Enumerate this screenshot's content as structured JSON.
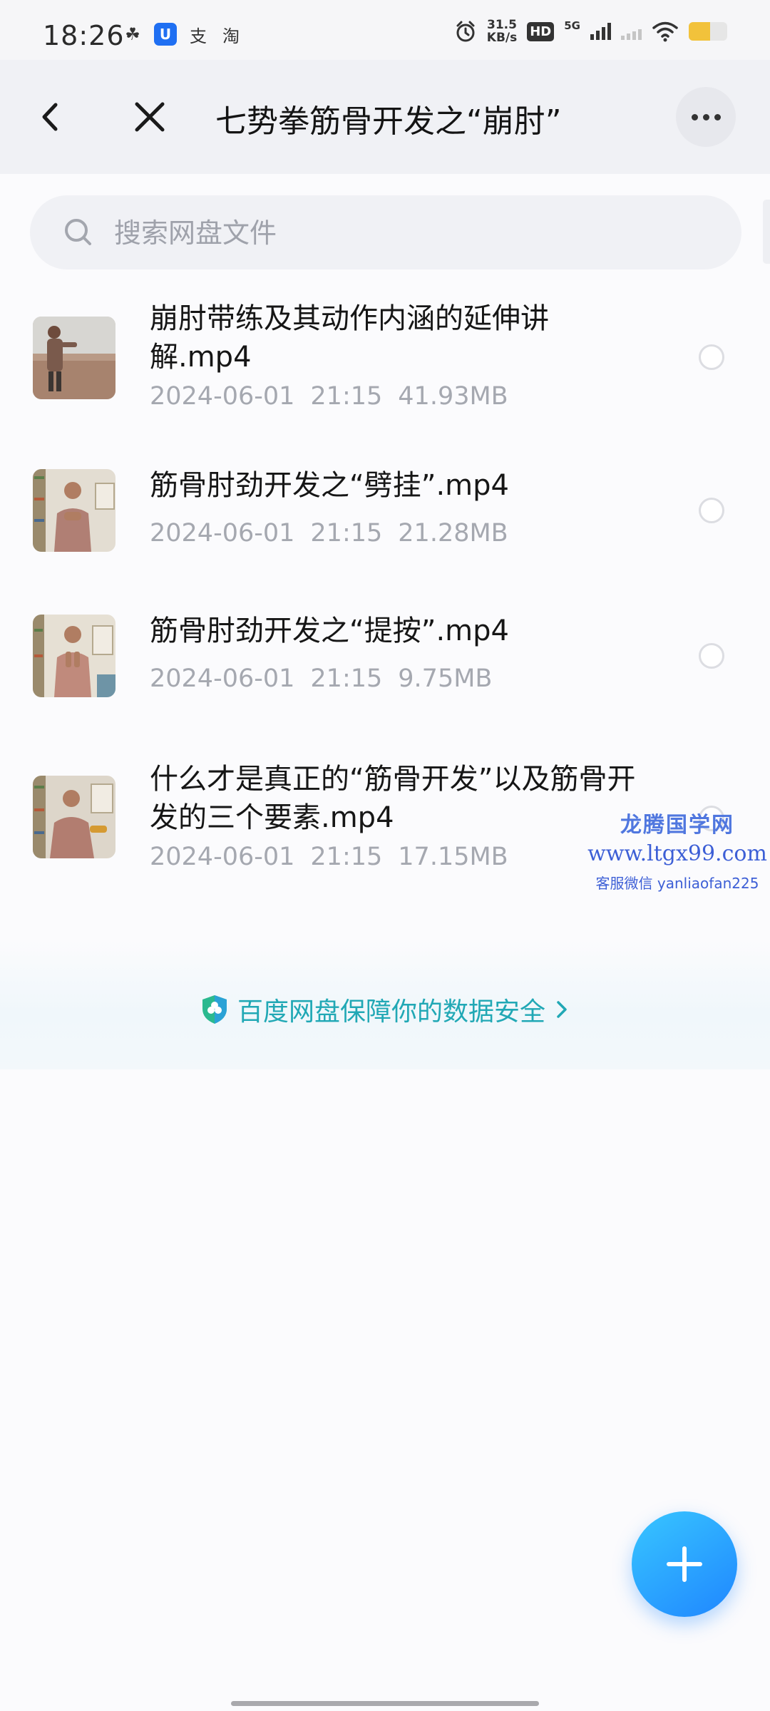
{
  "status_bar": {
    "time": "18:26",
    "app_icons": [
      "☘",
      "U",
      "支",
      "淘"
    ],
    "net_speed_value": "31.5",
    "net_speed_unit": "KB/s",
    "hd_badge": "HD",
    "network": "5G",
    "battery_level": 0.55,
    "accent_color": "#f2c23b"
  },
  "titlebar": {
    "title": "七势拳筋骨开发之“崩肘”",
    "back_icon": "chevron-left-icon",
    "close_icon": "close-icon",
    "more_icon": "more-icon"
  },
  "search": {
    "placeholder": "搜索网盘文件",
    "value": ""
  },
  "files": [
    {
      "name": "崩肘带练及其动作内涵的延伸讲解.mp4",
      "date": "2024-06-01",
      "time": "21:15",
      "size": "41.93MB"
    },
    {
      "name": "筋骨肘劲开发之“劈挂”.mp4",
      "date": "2024-06-01",
      "time": "21:15",
      "size": "21.28MB"
    },
    {
      "name": "筋骨肘劲开发之“提按”.mp4",
      "date": "2024-06-01",
      "time": "21:15",
      "size": "9.75MB"
    },
    {
      "name": "什么才是真正的“筋骨开发”以及筋骨开发的三个要素.mp4",
      "date": "2024-06-01",
      "time": "21:15",
      "size": "17.15MB"
    }
  ],
  "watermark": {
    "line1": "龙腾国学网",
    "line2": "www.ltgx99.com",
    "line3": "客服微信 yanliaofan225"
  },
  "security_banner": {
    "text": "百度网盘保障你的数据安全",
    "color": "#21a8b5"
  },
  "fab": {
    "icon": "plus-icon",
    "color": "#2a9dff"
  }
}
